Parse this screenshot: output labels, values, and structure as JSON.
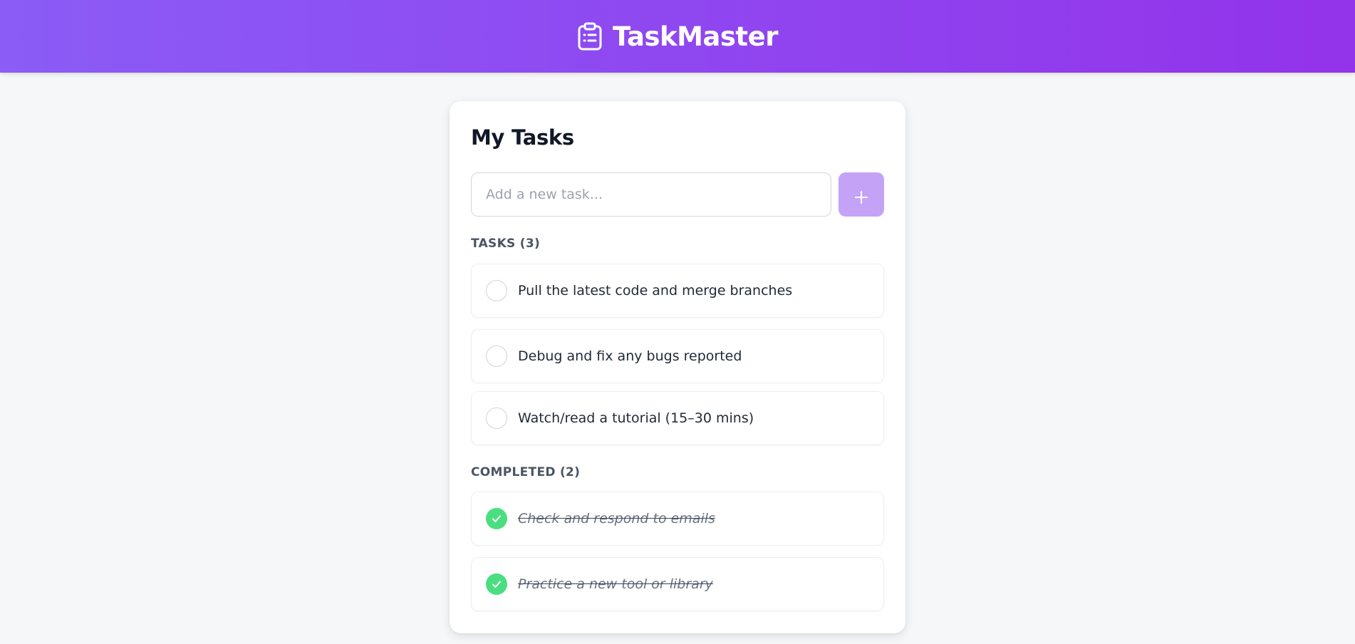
{
  "app": {
    "name": "TaskMaster",
    "brand_icon": "clipboard-list-icon",
    "header_gradient": [
      "#8b5cf6",
      "#9333ea"
    ]
  },
  "main": {
    "title": "My Tasks",
    "new_task": {
      "placeholder": "Add a new task...",
      "value": "",
      "add_button_icon": "plus-icon",
      "add_button_color": "#c4a3f7"
    },
    "tasks_section": {
      "label": "TASKS (3)",
      "items": [
        {
          "text": "Pull the latest code and merge branches",
          "completed": false
        },
        {
          "text": "Debug and fix any bugs reported",
          "completed": false
        },
        {
          "text": "Watch/read a tutorial (15–30 mins)",
          "completed": false
        }
      ]
    },
    "completed_section": {
      "label": "COMPLETED (2)",
      "items": [
        {
          "text": "Check and respond to emails",
          "completed": true
        },
        {
          "text": "Practice a new tool or library",
          "completed": true
        }
      ],
      "check_color": "#4ade80"
    }
  }
}
